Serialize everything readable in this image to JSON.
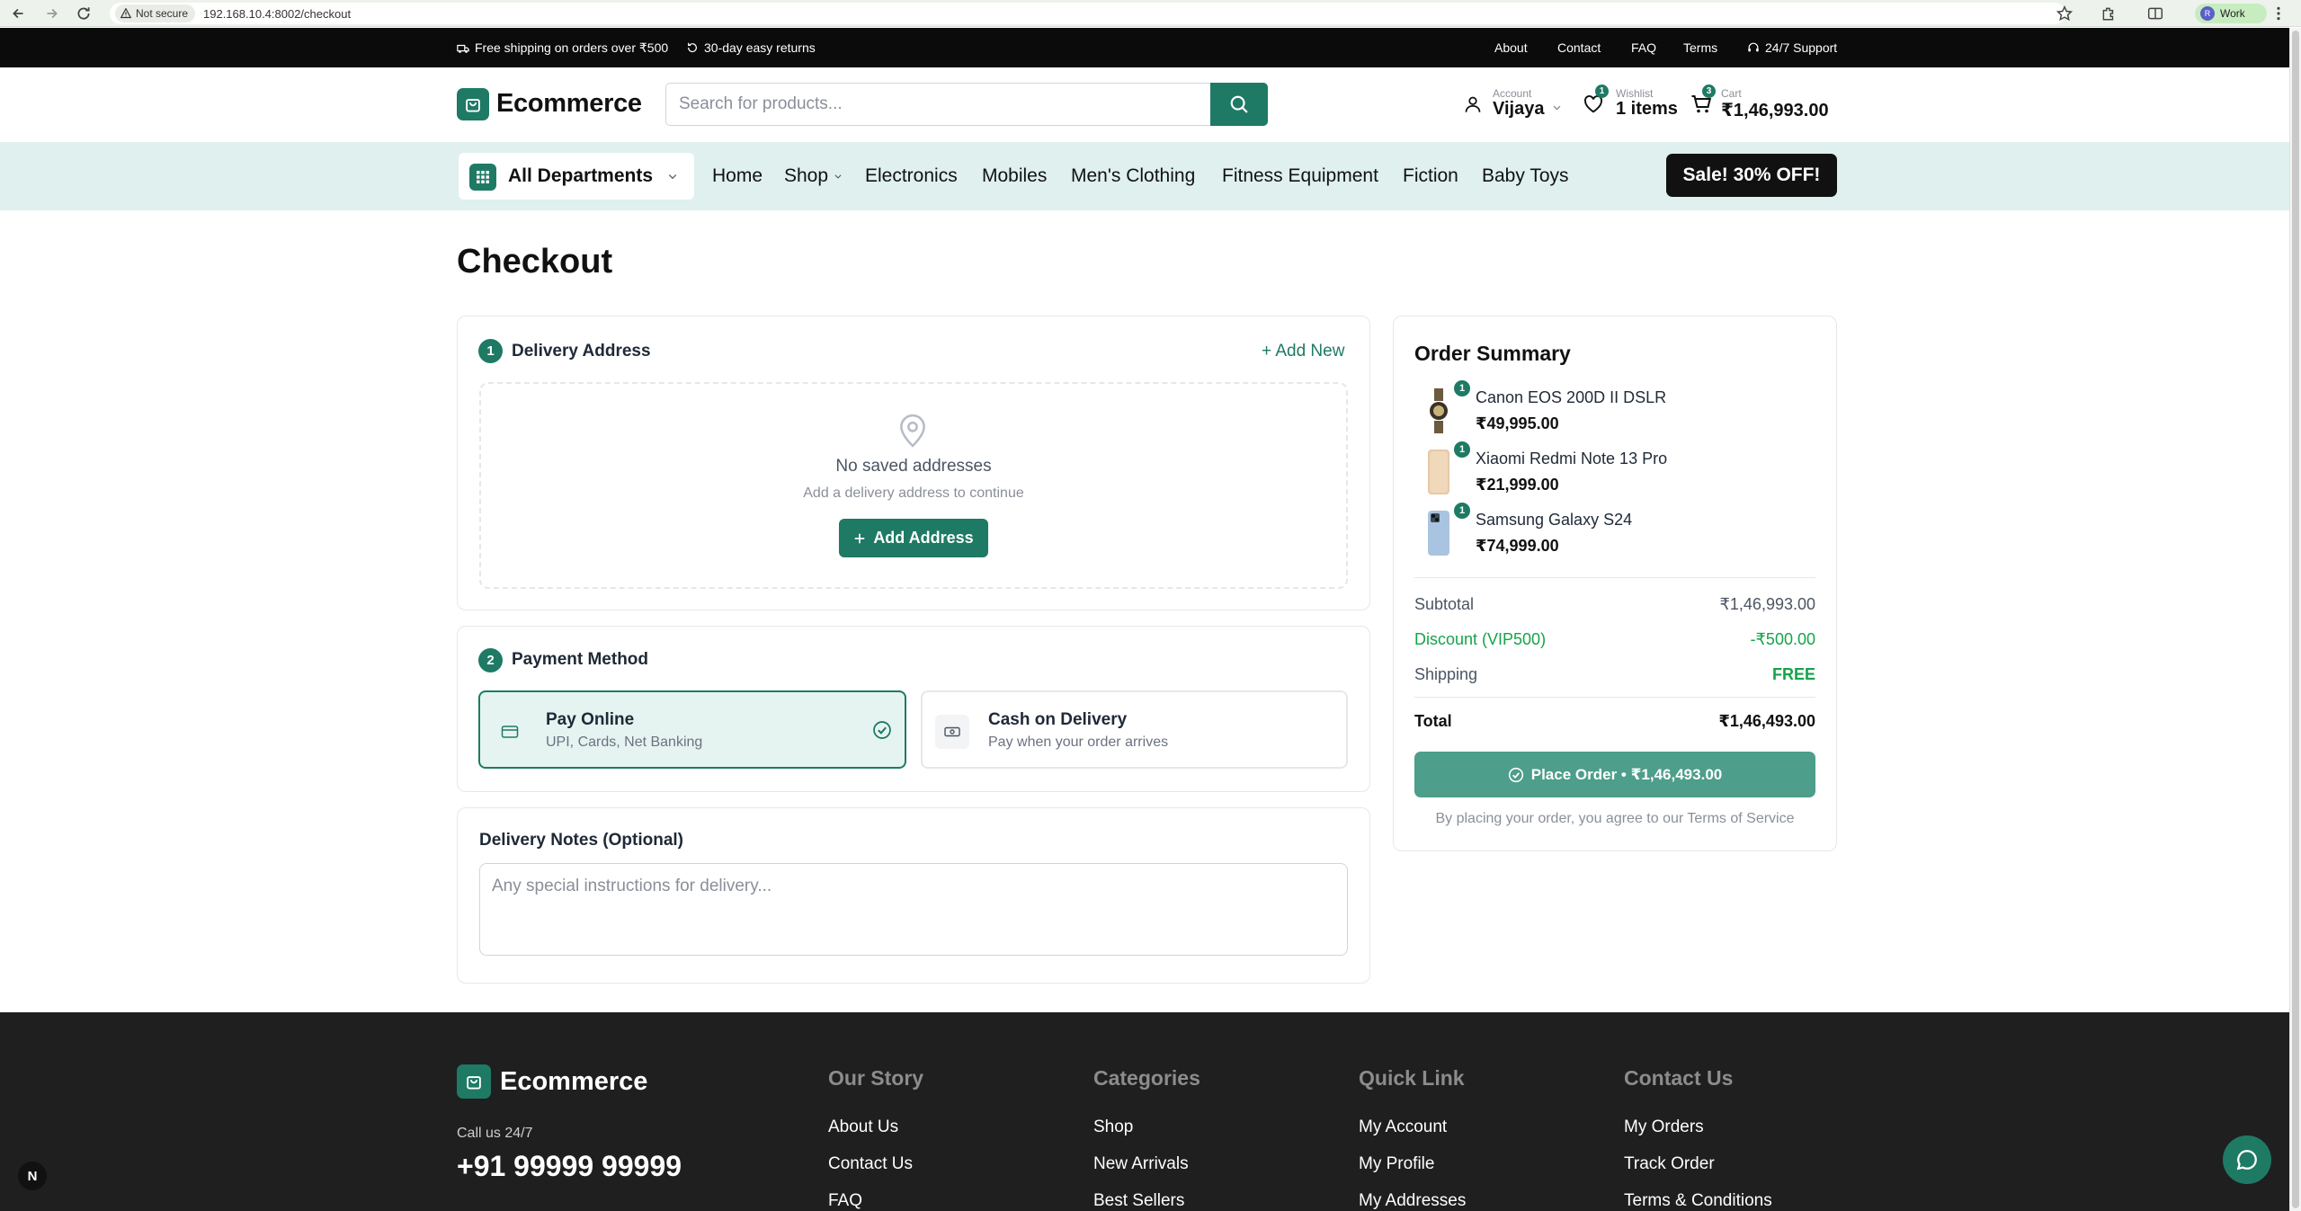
{
  "browser": {
    "security_label": "Not secure",
    "url": "192.168.10.4:8002/checkout",
    "profile_initial": "R",
    "profile_label": "Work"
  },
  "topbar": {
    "shipping": "Free shipping on orders over ₹500",
    "returns": "30-day easy returns",
    "links": [
      "About",
      "Contact",
      "FAQ",
      "Terms"
    ],
    "support": "24/7 Support"
  },
  "header": {
    "brand": "Ecommerce",
    "search_placeholder": "Search for products...",
    "account_label": "Account",
    "account_name": "Vijaya",
    "wishlist_label": "Wishlist",
    "wishlist_value": "1 items",
    "wishlist_count": "1",
    "cart_label": "Cart",
    "cart_value": "₹1,46,993.00",
    "cart_count": "3"
  },
  "nav": {
    "all_departments": "All Departments",
    "links": [
      "Home",
      "Shop",
      "Electronics",
      "Mobiles",
      "Men's Clothing",
      "Fitness Equipment",
      "Fiction",
      "Baby Toys"
    ],
    "sale": "Sale! 30% OFF!"
  },
  "checkout": {
    "title": "Checkout",
    "address": {
      "step": "1",
      "title": "Delivery Address",
      "add_new": "+ Add New",
      "empty_title": "No saved addresses",
      "empty_sub": "Add a delivery address to continue",
      "add_button": "Add Address"
    },
    "payment": {
      "step": "2",
      "title": "Payment Method",
      "options": [
        {
          "title": "Pay Online",
          "sub": "UPI, Cards, Net Banking"
        },
        {
          "title": "Cash on Delivery",
          "sub": "Pay when your order arrives"
        }
      ]
    },
    "notes": {
      "title": "Delivery Notes (Optional)",
      "placeholder": "Any special instructions for delivery..."
    }
  },
  "summary": {
    "title": "Order Summary",
    "items": [
      {
        "name": "Canon EOS 200D II DSLR",
        "price": "₹49,995.00",
        "qty": "1"
      },
      {
        "name": "Xiaomi Redmi Note 13 Pro",
        "price": "₹21,999.00",
        "qty": "1"
      },
      {
        "name": "Samsung Galaxy S24",
        "price": "₹74,999.00",
        "qty": "1"
      }
    ],
    "subtotal_label": "Subtotal",
    "subtotal_value": "₹1,46,993.00",
    "discount_label": "Discount (VIP500)",
    "discount_value": "-₹500.00",
    "shipping_label": "Shipping",
    "shipping_value": "FREE",
    "total_label": "Total",
    "total_value": "₹1,46,493.00",
    "place_order": "Place Order • ₹1,46,493.00",
    "terms": "By placing your order, you agree to our Terms of Service"
  },
  "footer": {
    "brand": "Ecommerce",
    "call_label": "Call us 24/7",
    "phone": "+91 99999 99999",
    "columns": [
      {
        "title": "Our Story",
        "links": [
          "About Us",
          "Contact Us",
          "FAQ"
        ]
      },
      {
        "title": "Categories",
        "links": [
          "Shop",
          "New Arrivals",
          "Best Sellers"
        ]
      },
      {
        "title": "Quick Link",
        "links": [
          "My Account",
          "My Profile",
          "My Addresses"
        ]
      },
      {
        "title": "Contact Us",
        "links": [
          "My Orders",
          "Track Order",
          "Terms & Conditions"
        ]
      }
    ]
  },
  "misc": {
    "next_badge": "N"
  },
  "colors": {
    "brand": "#1e7a64",
    "nav_bg": "#dff0ee",
    "discount": "#16a34a"
  }
}
